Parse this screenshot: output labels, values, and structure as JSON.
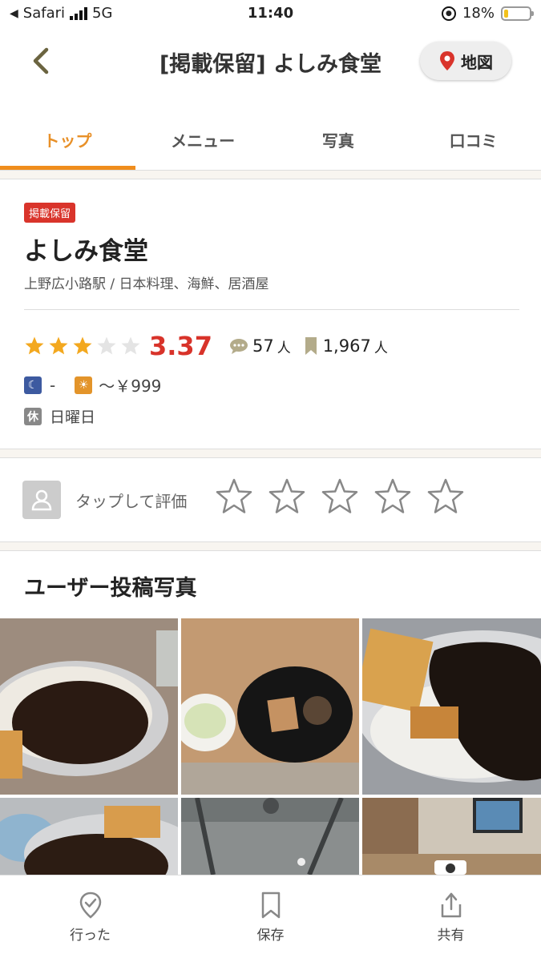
{
  "status_bar": {
    "carrier": "Safari",
    "network": "5G",
    "time": "11:40",
    "battery": "18%",
    "battery_level": 0.18
  },
  "header": {
    "title": "[掲載保留] よしみ食堂",
    "map_label": "地図"
  },
  "tabs": [
    {
      "label": "トップ",
      "active": true
    },
    {
      "label": "メニュー",
      "active": false
    },
    {
      "label": "写真",
      "active": false
    },
    {
      "label": "口コミ",
      "active": false
    }
  ],
  "restaurant": {
    "badge": "掲載保留",
    "name": "よしみ食堂",
    "subtitle": "上野広小路駅 / 日本料理、海鮮、居酒屋",
    "rating_stars": 3,
    "score": "3.37",
    "reviews_count": "57",
    "reviews_unit": "人",
    "saves_count": "1,967",
    "saves_unit": "人",
    "dinner_price": "-",
    "lunch_price": "～￥999",
    "holiday_icon": "休",
    "holiday": "日曜日"
  },
  "rating_prompt": {
    "label": "タップして評価",
    "star_count": 5
  },
  "photos": {
    "title": "ユーザー投稿写真"
  },
  "bottom_bar": {
    "visited": "行った",
    "save": "保存",
    "share": "共有"
  },
  "colors": {
    "accent": "#f08d1d",
    "score": "#d8332a",
    "badge": "#d9342b",
    "star": "#f3a81f"
  }
}
